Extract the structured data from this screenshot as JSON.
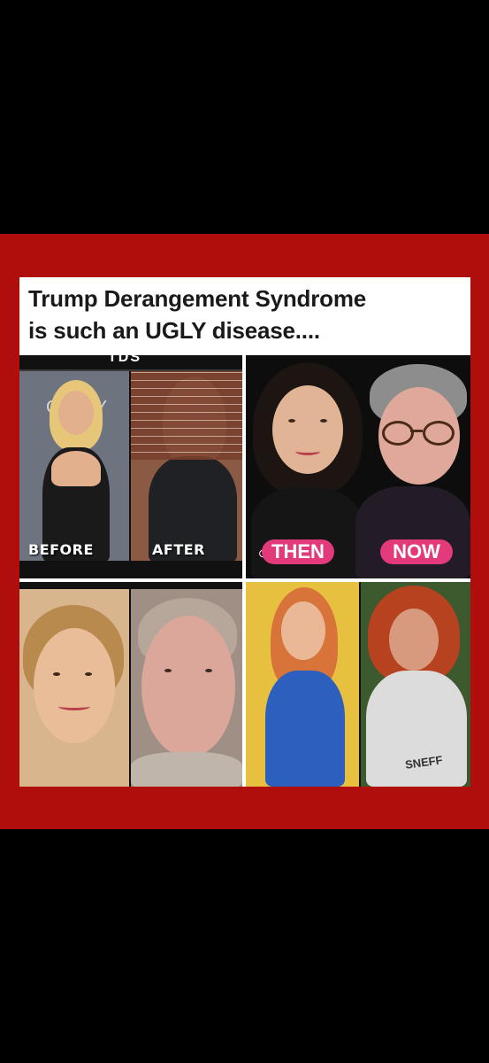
{
  "headline": {
    "line1": "Trump Derangement Syndrome",
    "line2": "is such an UGLY disease...."
  },
  "panels": {
    "top_left": {
      "strip_text": "TDS",
      "backdrop_text": "G   MY",
      "before_label": "BEFORE",
      "after_label": "AFTER"
    },
    "top_right": {
      "then_label": "THEN",
      "now_label": "NOW",
      "icon": "camera-icon"
    },
    "bottom_left": {},
    "bottom_right": {
      "shirt_text": "SNEFF"
    }
  },
  "colors": {
    "frame": "#b00d0d",
    "pill": "#e23a7a",
    "background": "#000000"
  }
}
